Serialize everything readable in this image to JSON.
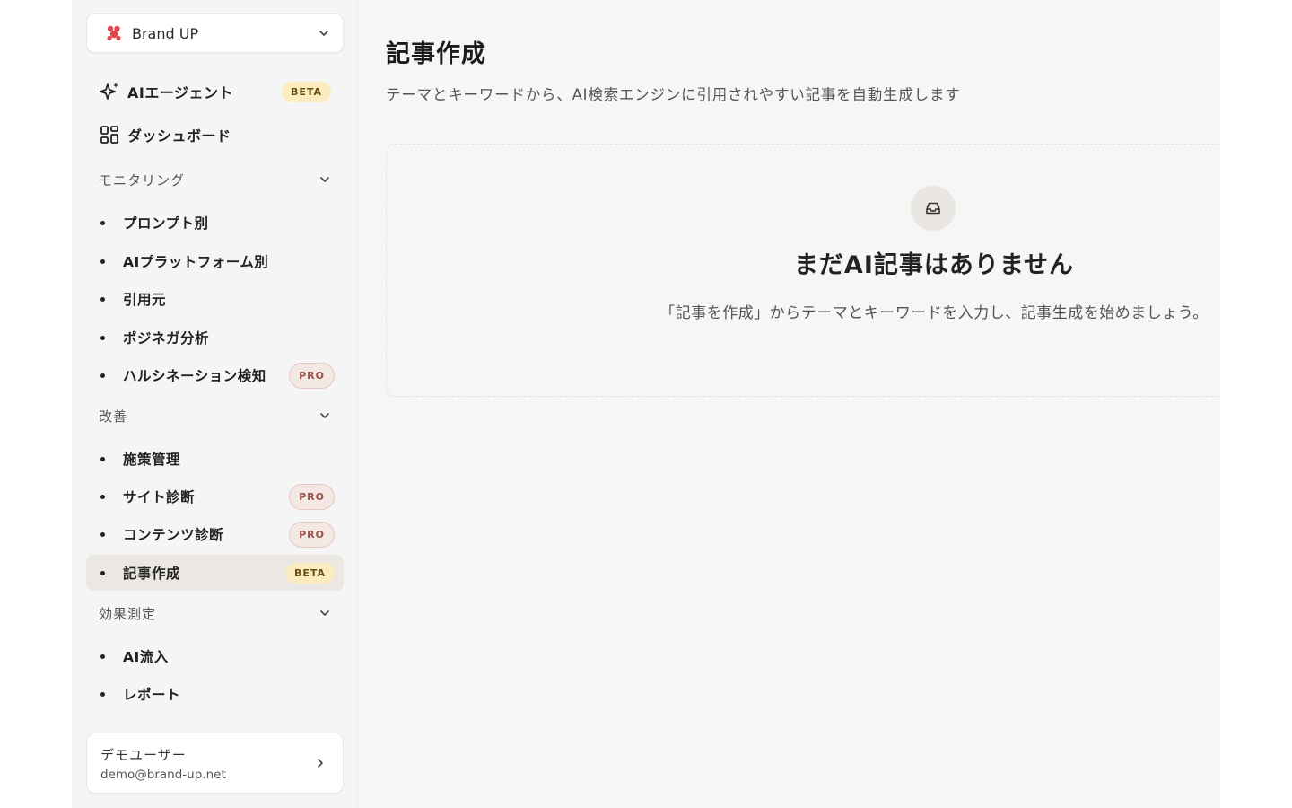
{
  "brand": {
    "name": "Brand UP"
  },
  "nav": {
    "ai_agent": {
      "label": "AIエージェント",
      "badge": "BETA"
    },
    "dashboard": {
      "label": "ダッシュボード"
    }
  },
  "sections": {
    "monitoring": {
      "label": "モニタリング",
      "items": [
        {
          "label": "プロンプト別"
        },
        {
          "label": "AIプラットフォーム別"
        },
        {
          "label": "引用元"
        },
        {
          "label": "ポジネガ分析"
        },
        {
          "label": "ハルシネーション検知",
          "badge": "PRO"
        }
      ]
    },
    "improvement": {
      "label": "改善",
      "items": [
        {
          "label": "施策管理"
        },
        {
          "label": "サイト診断",
          "badge": "PRO"
        },
        {
          "label": "コンテンツ診断",
          "badge": "PRO"
        },
        {
          "label": "記事作成",
          "badge": "BETA",
          "active": true
        }
      ]
    },
    "measurement": {
      "label": "効果測定",
      "items": [
        {
          "label": "AI流入"
        },
        {
          "label": "レポート"
        }
      ]
    }
  },
  "user": {
    "name": "デモユーザー",
    "email": "demo@brand-up.net"
  },
  "main": {
    "title": "記事作成",
    "subtitle": "テーマとキーワードから、AI検索エンジンに引用されやすい記事を自動生成します",
    "empty": {
      "title": "まだAI記事はありません",
      "description": "「記事を作成」からテーマとキーワードを入力し、記事生成を始めましょう。"
    }
  },
  "icons": {
    "brand_logo": "brand-logo-icon",
    "ai_agent": "sparkles-icon",
    "dashboard": "grid-icon",
    "empty": "inbox-icon"
  },
  "colors": {
    "beta_badge_bg": "#fbecc0",
    "pro_badge_bg": "#f4e8e4",
    "pro_badge_text": "#9a4f46",
    "brand_logo": "#e0474c"
  }
}
